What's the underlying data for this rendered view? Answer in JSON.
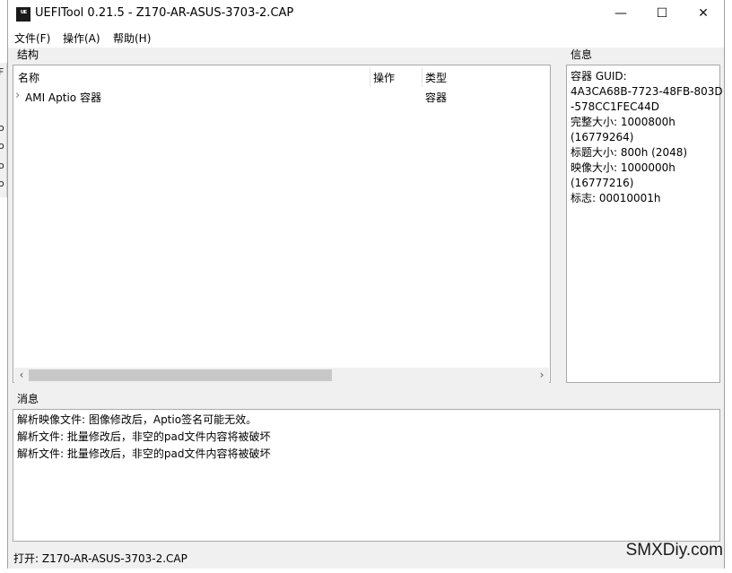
{
  "window": {
    "icon_text": "ᵁᴱ",
    "title": "UEFITool 0.21.5 - Z170-AR-ASUS-3703-2.CAP",
    "minimize": "—",
    "maximize": "☐",
    "close": "✕"
  },
  "bleed_chars": [
    "F",
    "o",
    "o",
    "o",
    "o"
  ],
  "menu": [
    {
      "label": "文件(F)"
    },
    {
      "label": "操作(A)"
    },
    {
      "label": "帮助(H)"
    }
  ],
  "structure": {
    "group_label": "结构",
    "columns": [
      "名称",
      "操作",
      "类型"
    ],
    "rows": [
      {
        "expander": "›",
        "name": "AMI Aptio 容器",
        "action": "",
        "type": "容器"
      }
    ],
    "scroll_left": "‹",
    "scroll_right": "›"
  },
  "info": {
    "group_label": "信息",
    "lines": [
      "容器 GUID:",
      "4A3CA68B-7723-48FB-803D",
      "-578CC1FEC44D",
      "完整大小: 1000800h",
      "(16779264)",
      "标题大小: 800h (2048)",
      "映像大小: 1000000h",
      "(16777216)",
      "标志: 00010001h"
    ]
  },
  "messages": {
    "group_label": "消息",
    "lines": [
      "解析映像文件: 图像修改后，Aptio签名可能无效。",
      "解析文件: 批量修改后，非空的pad文件内容将被破坏",
      "解析文件: 批量修改后，非空的pad文件内容将被破坏"
    ]
  },
  "status": {
    "text": "打开: Z170-AR-ASUS-3703-2.CAP"
  },
  "watermark": "SMXDiy.com"
}
